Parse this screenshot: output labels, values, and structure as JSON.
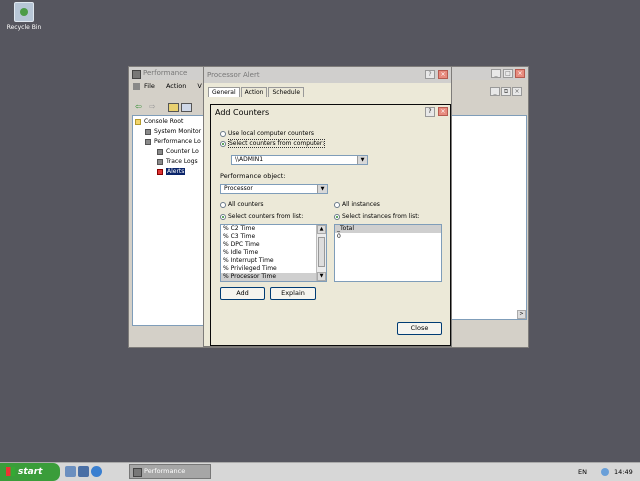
{
  "desktop": {
    "recycle_bin_label": "Recycle Bin"
  },
  "perf_window": {
    "title": "Performance",
    "menu": [
      "File",
      "Action",
      "V"
    ],
    "tree": {
      "root": "Console Root",
      "system_monitor": "System Monitor",
      "perf_logs": "Performance Lo",
      "counter_logs": "Counter Lo",
      "trace_logs": "Trace Logs",
      "alerts": "Alerts"
    }
  },
  "alert_dialog": {
    "title": "Processor Alert",
    "tabs": [
      "General",
      "Action",
      "Schedule"
    ]
  },
  "add_counters": {
    "title": "Add Counters",
    "help_label": "?",
    "use_local_label": "Use local computer counters",
    "select_from_computer_label": "Select counters from computer:",
    "computer_value": "\\\\ADMIN1",
    "performance_object_label": "Performance object:",
    "performance_object_value": "Processor",
    "all_counters_label": "All counters",
    "select_counters_label": "Select counters from list:",
    "counters": [
      "% C2 Time",
      "% C3 Time",
      "% DPC Time",
      "% Idle Time",
      "% Interrupt Time",
      "% Privileged Time",
      "% Processor Time"
    ],
    "all_instances_label": "All instances",
    "select_instances_label": "Select instances from list:",
    "instances": [
      "_Total",
      "0"
    ],
    "add_button": "Add",
    "explain_button": "Explain",
    "close_button": "Close"
  },
  "taskbar": {
    "start_label": "start",
    "task_label": "Performance",
    "language": "EN",
    "clock": "14:49"
  },
  "colors": {
    "desktop": "#56565f",
    "taskbar": "#d7d7d7",
    "start": "#3a9d3a"
  }
}
